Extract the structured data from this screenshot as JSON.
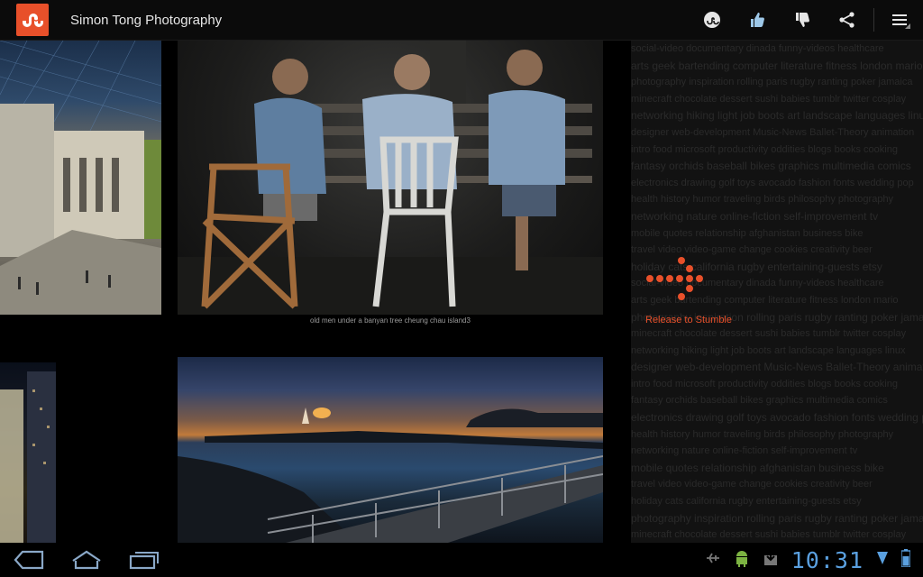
{
  "app": {
    "title": "Simon Tong Photography",
    "logo_icon": "stumbleupon-logo-icon",
    "accent": "#e8502a"
  },
  "actionbar": {
    "icons": [
      "stumble-icon",
      "thumbs-up-icon",
      "thumbs-down-icon",
      "share-icon",
      "menu-icon"
    ]
  },
  "photos": [
    {
      "name": "museum-photo"
    },
    {
      "name": "old-men-photo",
      "caption": "old men under a banyan tree cheung chau island3"
    },
    {
      "name": "city-night-photo"
    },
    {
      "name": "sunset-pier-photo"
    }
  ],
  "stumble": {
    "label": "Release to Stumble"
  },
  "tagcloud": {
    "lines": [
      "social-video   documentary   dinada   funny-videos   healthcare",
      "arts   geek   bartending   computer   literature   fitness   london   mario",
      "photography   inspiration   rolling   paris   rugby   ranting   poker   jamaica",
      "minecraft   chocolate   dessert   sushi   babies   tumblr   twitter   cosplay",
      "networking   hiking   light   job   boots   art   landscape   languages   linux",
      "designer   web-development   Music-News   Ballet-Theory   animation",
      "intro   food   microsoft   productivity   oddities   blogs   books   cooking",
      "fantasy   orchids   baseball   bikes   graphics   multimedia   comics",
      "electronics   drawing   golf   toys   avocado   fashion   fonts   wedding   pop",
      "health   history   humor   traveling   birds   philosophy   photography",
      "networking   nature   online-fiction   self-improvement   tv",
      "mobile   quotes   relationship   afghanistan   business   bike",
      "travel   video   video-game   change   cookies   creativity   beer",
      "holiday   cats   california   rugby   entertaining-guests   etsy",
      "social-video   documentary   dinada   funny-videos   healthcare",
      "arts   geek   bartending   computer   literature   fitness   london   mario",
      "photography   inspiration   rolling   paris   rugby   ranting   poker   jamaica",
      "minecraft   chocolate   dessert   sushi   babies   tumblr   twitter   cosplay",
      "networking   hiking   light   job   boots   art   landscape   languages   linux",
      "designer   web-development   Music-News   Ballet-Theory   animation",
      "intro   food   microsoft   productivity   oddities   blogs   books   cooking",
      "fantasy   orchids   baseball   bikes   graphics   multimedia   comics",
      "electronics   drawing   golf   toys   avocado   fashion   fonts   wedding   pop",
      "health   history   humor   traveling   birds   philosophy   photography",
      "networking   nature   online-fiction   self-improvement   tv",
      "mobile   quotes   relationship   afghanistan   business   bike",
      "travel   video   video-game   change   cookies   creativity   beer",
      "holiday   cats   california   rugby   entertaining-guests   etsy",
      "photography   inspiration   rolling   paris   rugby   ranting   poker   jamaica",
      "minecraft   chocolate   dessert   sushi   babies   tumblr   twitter   cosplay"
    ]
  },
  "navbar": {
    "icons": [
      "back-icon",
      "home-icon",
      "recent-apps-icon"
    ]
  },
  "statusbar": {
    "icons": [
      "usb-debug-icon",
      "android-icon",
      "download-icon",
      "wifi-icon",
      "battery-icon"
    ],
    "time": "10:31"
  }
}
